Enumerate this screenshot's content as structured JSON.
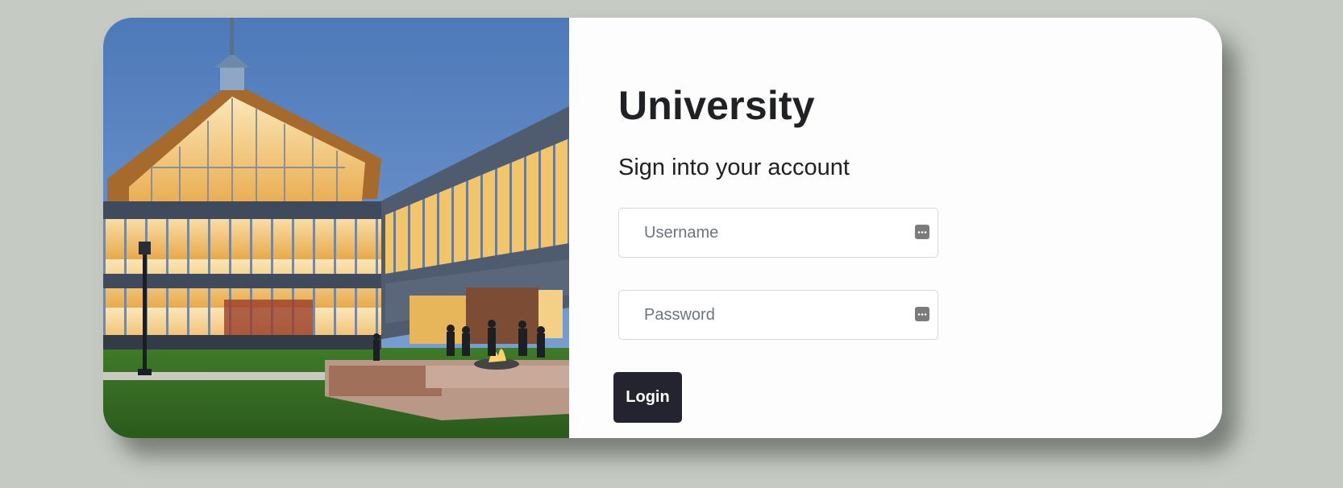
{
  "brand": {
    "name": "University"
  },
  "form": {
    "subtitle": "Sign into your account",
    "username_placeholder": "Username",
    "username_value": "",
    "password_placeholder": "Password",
    "password_value": "",
    "login_label": "Login",
    "field_icon": "password-manager-key-icon"
  },
  "colors": {
    "page_background": "#c5cac3",
    "card_background": "#fdfdfd",
    "button_background": "#242430",
    "text": "#202124"
  }
}
